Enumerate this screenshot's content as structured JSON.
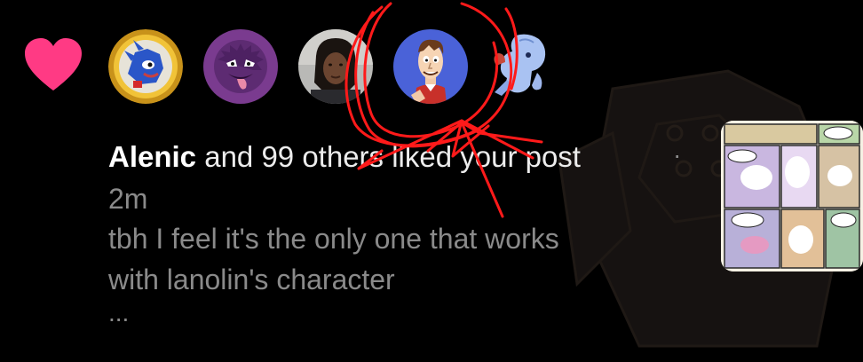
{
  "notification": {
    "type_icon": "heart-icon",
    "avatars": [
      {
        "name": "avatar-sonic-medal"
      },
      {
        "name": "avatar-purple-ghost"
      },
      {
        "name": "avatar-person"
      },
      {
        "name": "avatar-cartoon-man"
      },
      {
        "name": "avatar-partial-character"
      }
    ],
    "actor_name": "Alenic",
    "action_text": " and 99 others liked your post",
    "separator": "·",
    "time_ago": "2m",
    "post_snippet": "tbh I feel it's the only one that works\nwith lanolin's character",
    "truncation": "...",
    "thumbnail": "post-thumbnail-comic"
  },
  "colors": {
    "heart": "#ff3a84",
    "annotation": "#ff1a1a",
    "secondary_text": "#8a8a8a"
  }
}
